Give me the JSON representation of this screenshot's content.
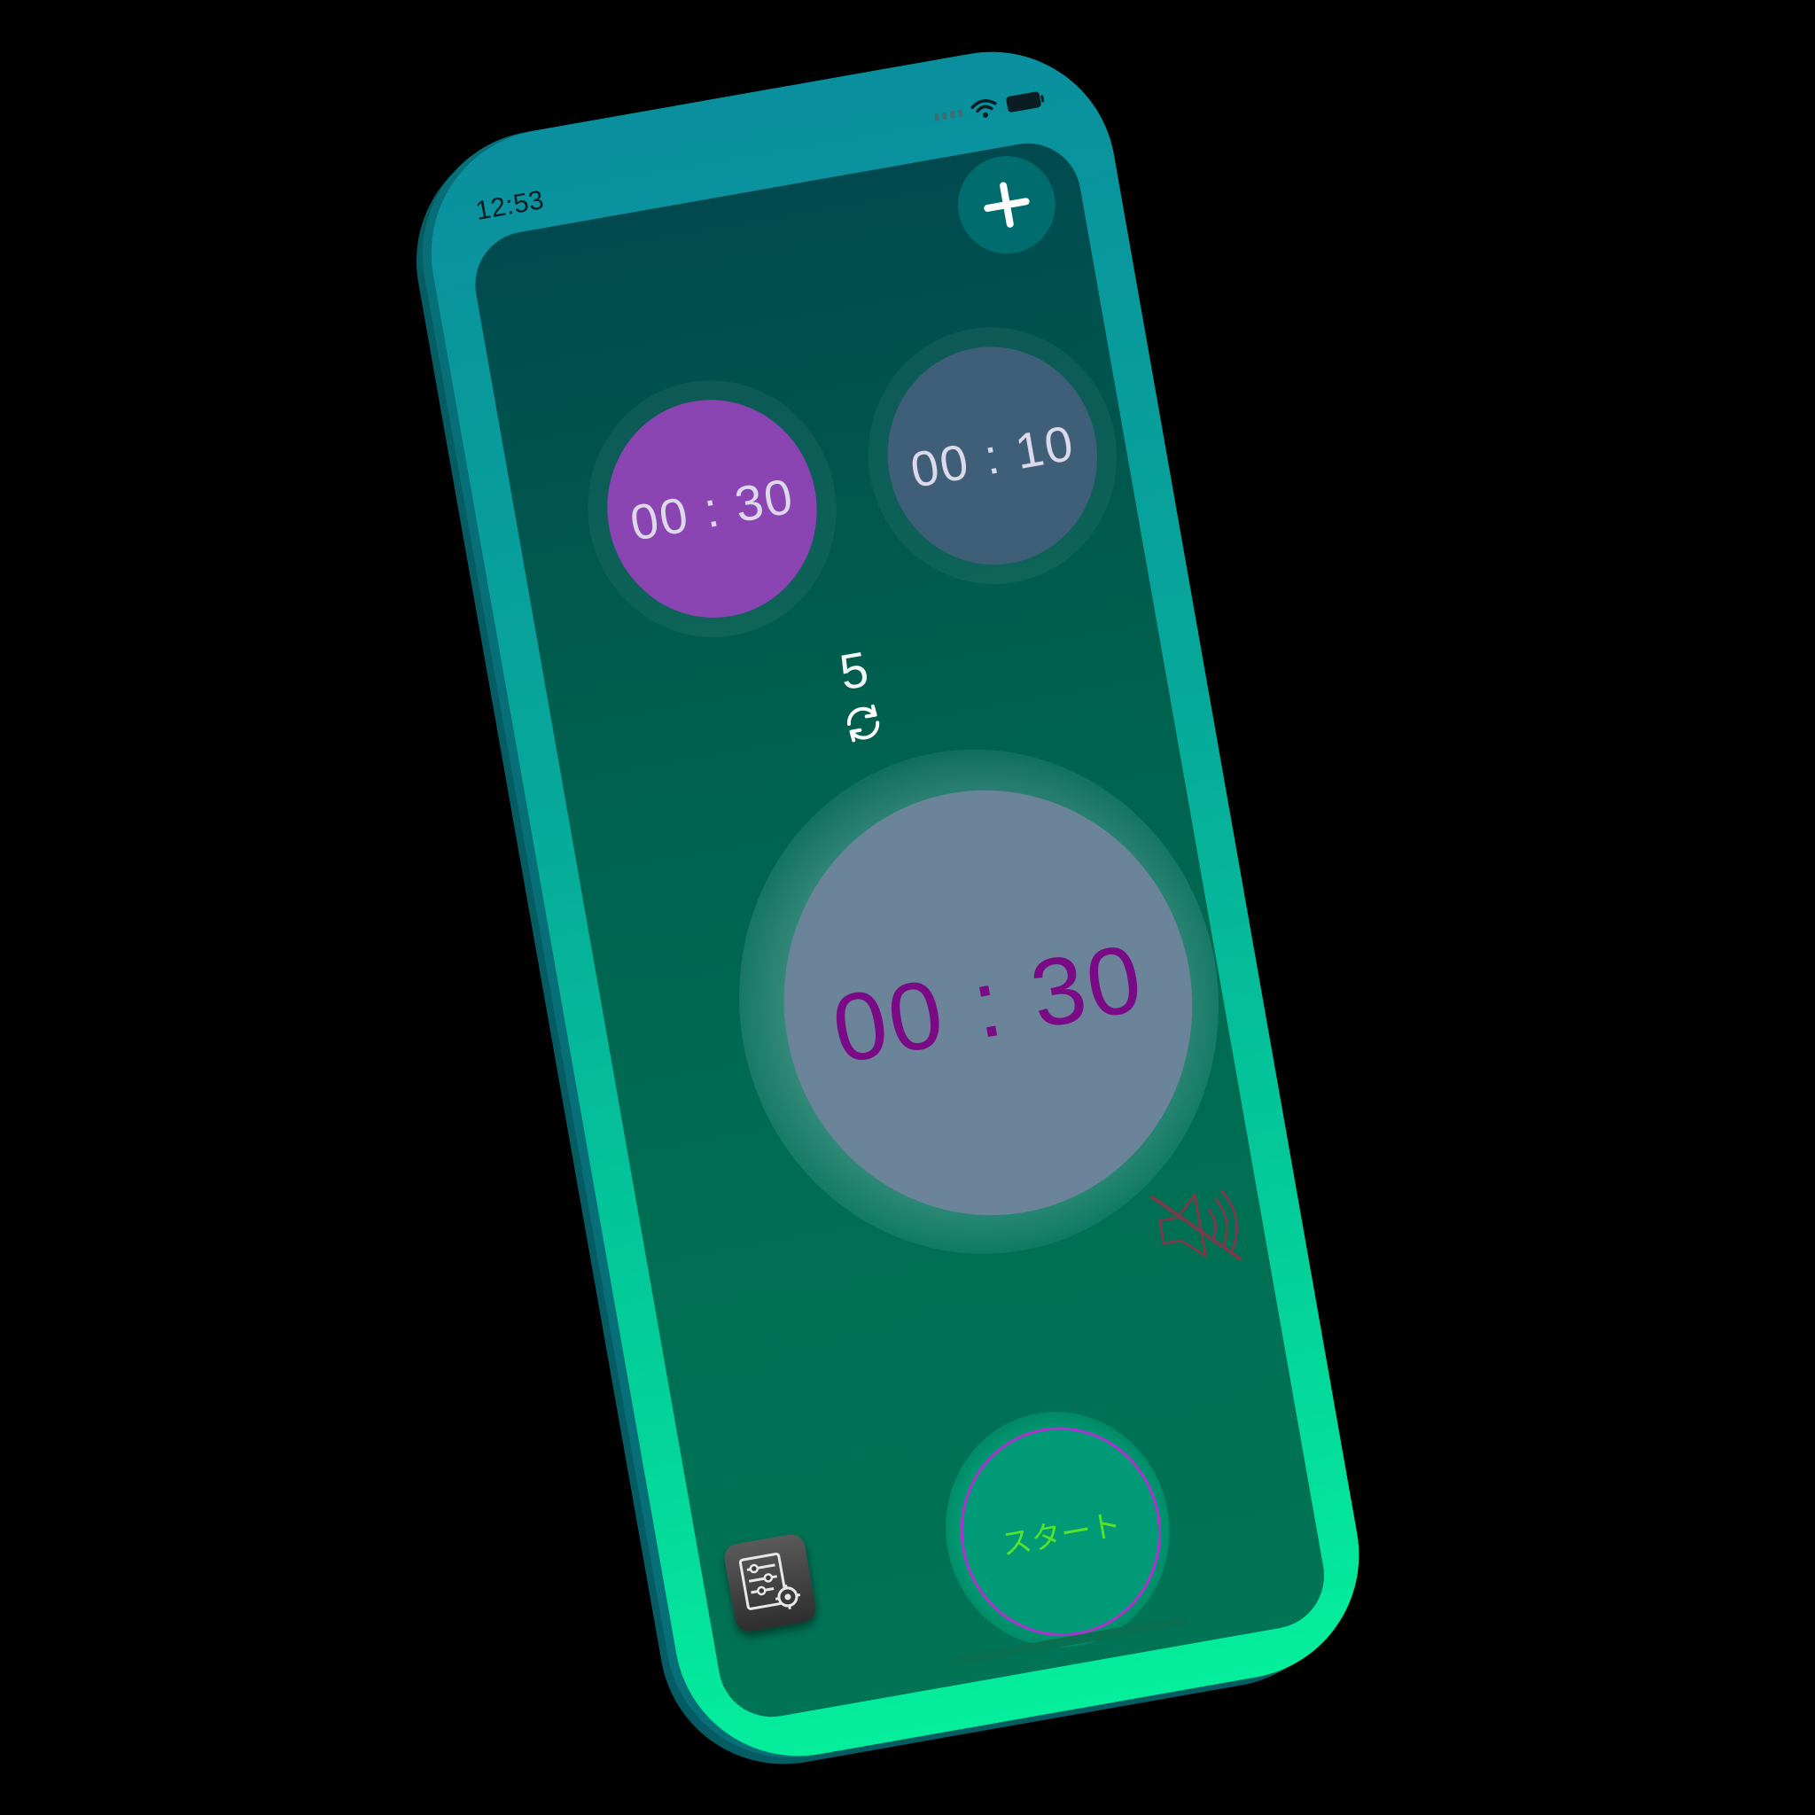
{
  "status_bar": {
    "time": "12:53"
  },
  "toolbar": {
    "add_label": "+",
    "add_icon": "plus-icon"
  },
  "timers": [
    {
      "minutes": "00",
      "separator": ":",
      "seconds": "30",
      "selected": true,
      "color": "#8a45b3"
    },
    {
      "minutes": "00",
      "separator": ":",
      "seconds": "10",
      "selected": false,
      "color": "#3f5f79"
    }
  ],
  "repeat": {
    "count": "5",
    "icon": "repeat-icon"
  },
  "main_timer": {
    "minutes": "00",
    "separator": ":",
    "seconds": "30",
    "color": "#7a0a86"
  },
  "sound": {
    "muted": true,
    "icon": "speaker-muted-icon"
  },
  "settings": {
    "icon": "settings-sliders-icon"
  },
  "start": {
    "label": "スタート",
    "label_color": "#55e22d",
    "border_color": "#b22fd0"
  },
  "colors": {
    "phone_top": "#0a8f9e",
    "phone_bottom": "#05ee9c",
    "screen_top": "#004a4f",
    "screen_bottom": "#007455"
  }
}
